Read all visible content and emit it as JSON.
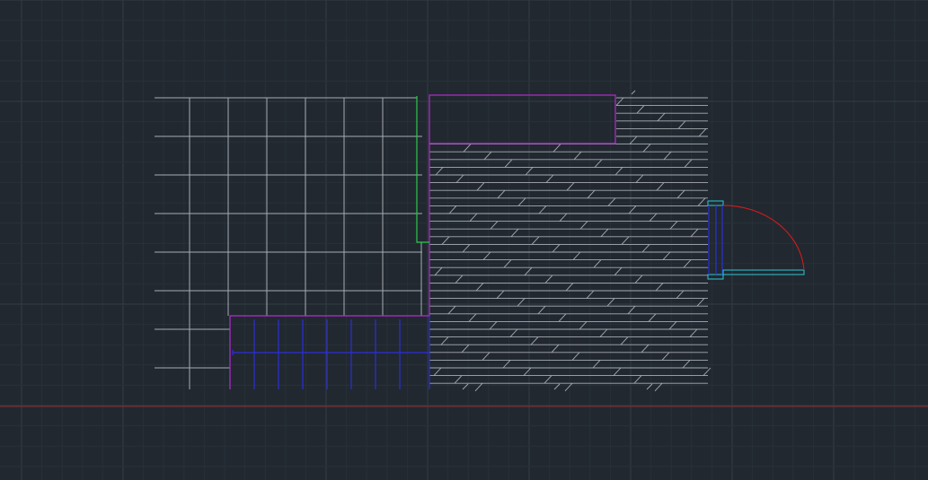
{
  "canvas": {
    "background": "#212830",
    "grid_minor_color": "#283038",
    "grid_major_color": "#333b44",
    "axis_line_color": "#8a2a2e"
  },
  "drawing": {
    "colors": {
      "grid_lines": "#a8acb2",
      "hatch_lines": "#a8acb2",
      "magenta": "#b42bd1",
      "green": "#2ec84a",
      "blue": "#2c2fd8",
      "cyan": "#2bc9d6",
      "red": "#c81c1c"
    }
  }
}
